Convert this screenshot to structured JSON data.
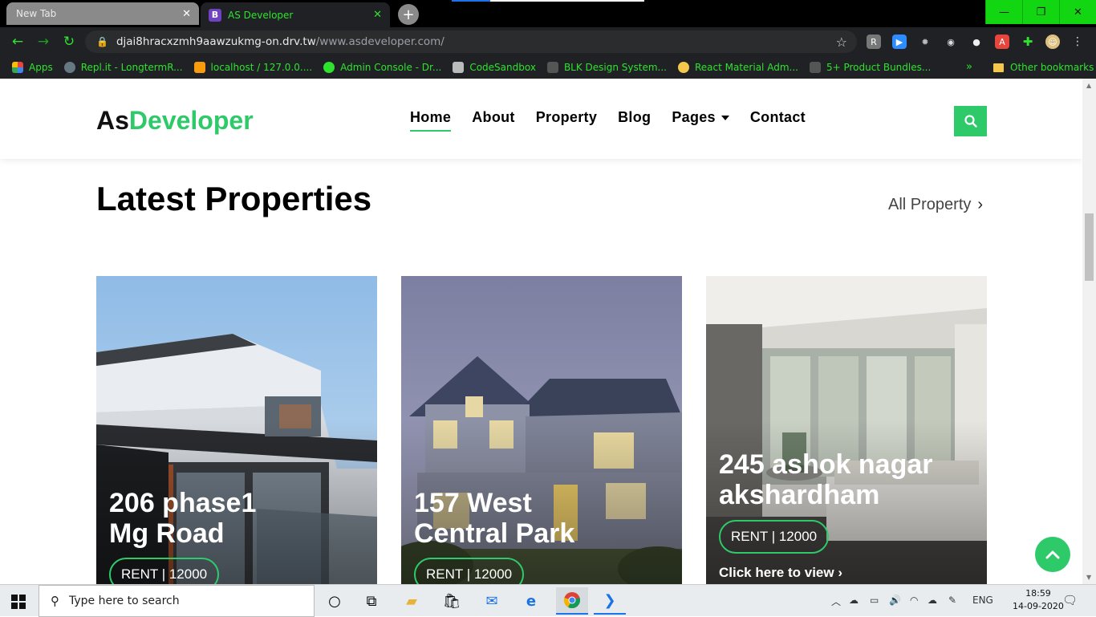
{
  "browser": {
    "tabs": [
      {
        "title": "New Tab",
        "active": false
      },
      {
        "title": "AS Developer",
        "active": true,
        "favicon": "B"
      }
    ],
    "url_host": "djai8hracxzmh9aawzukmg-on.drv.tw",
    "url_path": "/www.asdeveloper.com/",
    "bookmarks": [
      {
        "label": "Apps",
        "icon": "apps-grid-icon",
        "color": "#e8453c"
      },
      {
        "label": "Repl.it - LongtermR...",
        "icon": "replit-icon",
        "color": "#667881"
      },
      {
        "label": "localhost / 127.0.0....",
        "icon": "phpmyadmin-icon",
        "color": "#f89c0e"
      },
      {
        "label": "Admin Console - Dr...",
        "icon": "globe-icon",
        "color": "#2ee32e"
      },
      {
        "label": "CodeSandbox",
        "icon": "codesandbox-icon",
        "color": "#bbbbbb"
      },
      {
        "label": "BLK Design System...",
        "icon": "blk-icon",
        "color": "#333333"
      },
      {
        "label": "React Material Adm...",
        "icon": "react-material-icon",
        "color": "#f5c84c"
      },
      {
        "label": "5+ Product Bundles...",
        "icon": "bundle-icon",
        "color": "#333333"
      }
    ],
    "more": "»",
    "other_bookmarks": "Other bookmarks"
  },
  "site": {
    "logo_as": "As",
    "logo_dev": "Developer",
    "nav": [
      "Home",
      "About",
      "Property",
      "Blog",
      "Pages",
      "Contact"
    ],
    "active_nav": "Home",
    "accent": "#2eca6a"
  },
  "section": {
    "title": "Latest Properties",
    "all_link": "All Property"
  },
  "cards": [
    {
      "title_line1": "206 phase1",
      "title_line2": "Mg Road",
      "price": "RENT | 12000"
    },
    {
      "title_line1": "157 West",
      "title_line2": "Central Park",
      "price": "RENT | 12000"
    },
    {
      "title_line1": "245 ashok nagar",
      "title_line2": "akshardham",
      "price": "RENT | 12000",
      "cta": "Click here to view"
    }
  ],
  "taskbar": {
    "search_placeholder": "Type here to search",
    "lang": "ENG",
    "time": "18:59",
    "date": "14-09-2020"
  }
}
